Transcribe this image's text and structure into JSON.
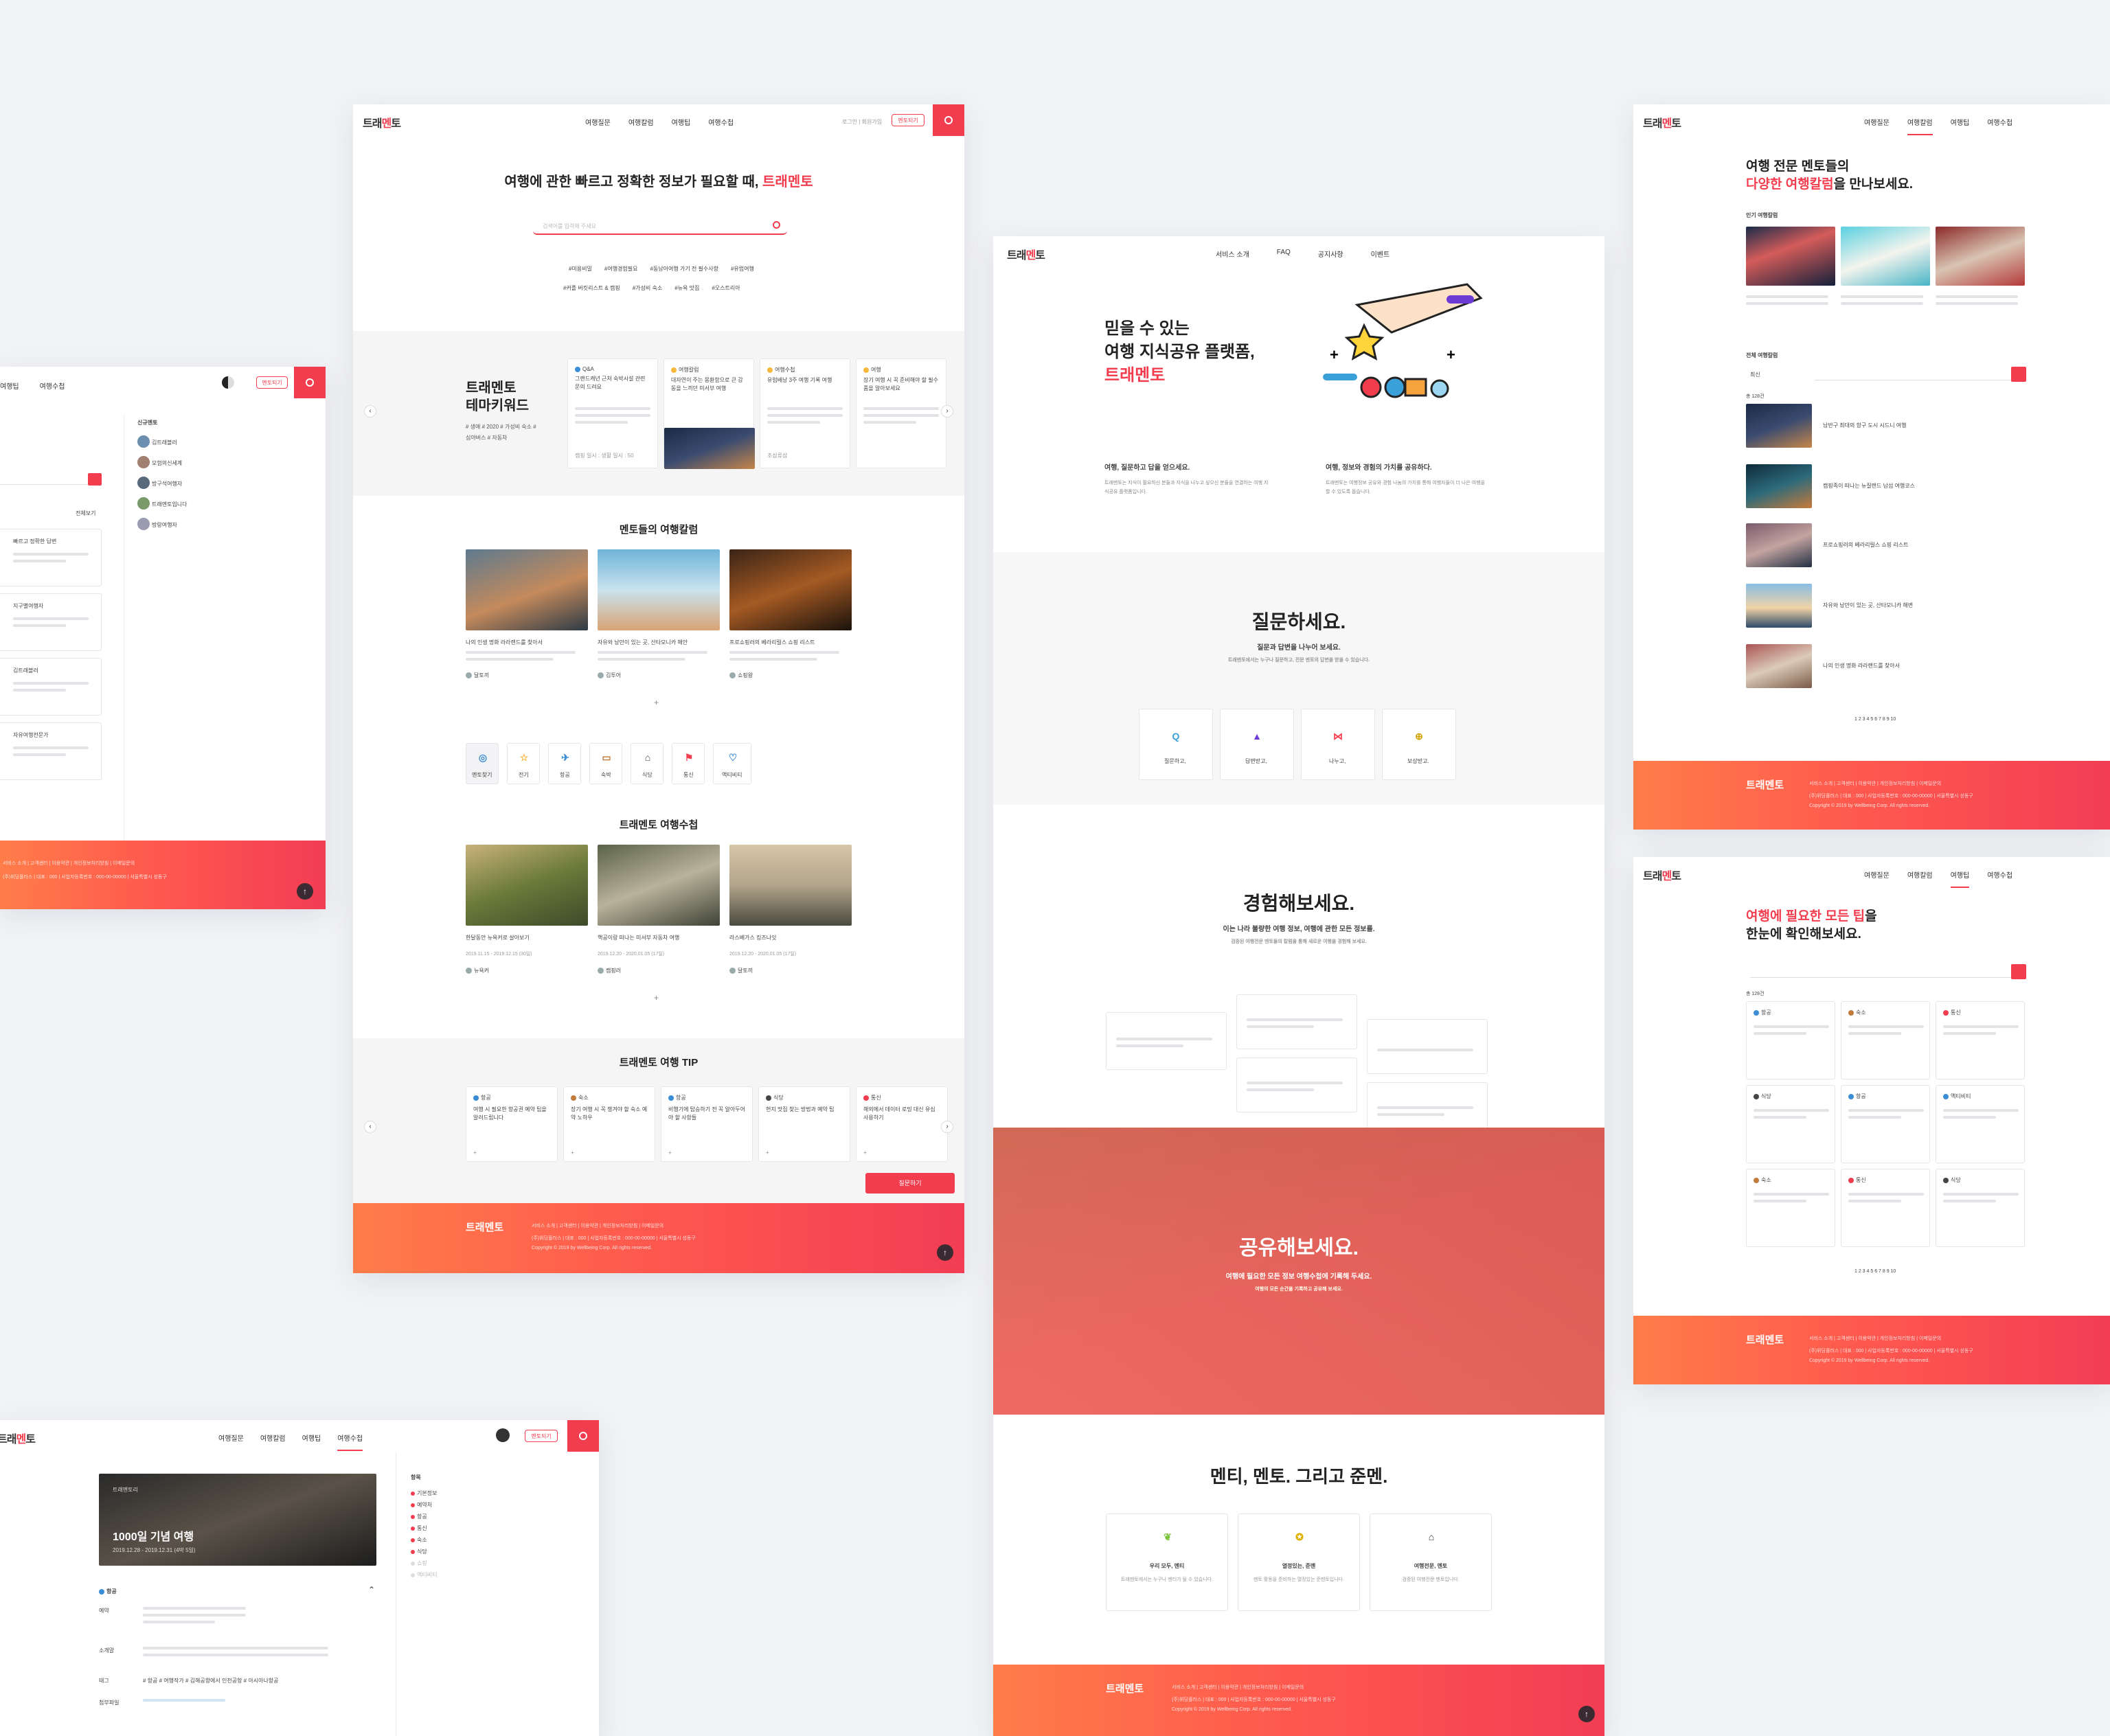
{
  "brand": {
    "logo_a": "트래",
    "logo_b": "멘",
    "logo_c": "토",
    "accent": "#f23d4f"
  },
  "nav": {
    "qa": "여행질문",
    "column": "여행칼럼",
    "tip": "여행팁",
    "essay": "여행수첩",
    "login": "로그인",
    "join": "회원가입",
    "mentor": "멘토되기"
  },
  "nav2": {
    "about": "서비스 소개",
    "faq": "FAQ",
    "notice": "공지사항",
    "event": "이벤트"
  },
  "main": {
    "hero_a": "여행에 관한 빠르고 정확한 정보가 필요할 때, ",
    "hero_b": "트래멘토",
    "search_placeholder": "검색어를 입력해 주세요",
    "tags1": [
      "#미용비밀",
      "#여행경험필요",
      "#동남아여행 가기 전 필수사항",
      "#유럽여행"
    ],
    "tags2": [
      "#커플 버킷리스트 & 캠핑",
      "#가성비 숙소",
      "#뉴욕 맛집",
      "#오스트리아"
    ],
    "keyword_title_1": "트래멘토",
    "keyword_title_2": "테마키워드",
    "keyword_tags": "# 생애  # 2020  # 가성비 숙소  # 심야버스  # 자동차",
    "theme_cards": [
      {
        "cat": "Q&A",
        "text": "그랜드캐년 근처 숙박시설 관련 문의 드려요",
        "user": "캠핑 일시 : 생활 일시 : 50"
      },
      {
        "cat": "여행칼럼",
        "text": "대자연이 주는 몽환함으로 큰 감동을 느끼던 미서부 여행",
        "user": "별나라"
      },
      {
        "cat": "여행수첩",
        "text": "유럽배낭 3주 여행 기록 여행",
        "user": "조삼류삼"
      },
      {
        "cat": "여행",
        "text": "장기 여행 시 꼭 준비해야 할 필수품을 알아보세요",
        "user": ""
      }
    ],
    "column_title": "멘토들의 여행칼럼",
    "columns": [
      {
        "title": "나의 인생 명화 라라랜드를 찾아서",
        "user": "달토끼"
      },
      {
        "title": "자유와 낭만이 있는 곳, 산타모니카 해안",
        "user": "김투어"
      },
      {
        "title": "프로쇼핑러의 베라리릴스 쇼핑 리스트",
        "user": "쇼핑왕"
      }
    ],
    "categories": [
      "멘토찾기",
      "전기",
      "항공",
      "숙박",
      "식당",
      "통신",
      "액티비티"
    ],
    "essay_title": "트래멘토 여행수첩",
    "essays": [
      {
        "title": "한달동안 뉴욕커로 살아보기",
        "meta": "2019.11.15 - 2019.12.15 (30일)",
        "user": "뉴욕커"
      },
      {
        "title": "핵공이랑 떠나는 미서부 자동차 여행",
        "meta": "2019.12.20 - 2020.01.05 (17일)",
        "user": "캠핑러"
      },
      {
        "title": "라스베가스 킹즈나잇",
        "meta": "2019.12.20 - 2020.01.05 (17일)",
        "user": "달토끼"
      }
    ],
    "tip_title": "트래멘토 여행 TIP",
    "tips": [
      {
        "cat": "항공",
        "text": "여행 시 필요한 항공권 예약 팁을 알려드립니다"
      },
      {
        "cat": "숙소",
        "text": "장기 여행 시 꼭 챙겨야 할 숙소 예약 노하우"
      },
      {
        "cat": "항공",
        "text": "비행기에 탑승하기 전 꼭 알아두어야 할 사항들"
      },
      {
        "cat": "식당",
        "text": "현지 맛집 찾는 방법과 예약 팁"
      },
      {
        "cat": "통신",
        "text": "해외에서 데이터 로밍 대신 유심 사용하기"
      }
    ],
    "more_button": "질문하기"
  },
  "footer": {
    "logo": "트래멘토",
    "links": "서비스 소개 | 고객센터 | 이용약관 | 개인정보처리방침 | 이메일문의",
    "info": "(주)위딩플러스 | 대표 : 000 | 사업자등록번호 : 000-00-00000 | 서울특별시 성동구",
    "copy": "Copyright © 2019 by Wellbeing Corp. All rights reserved."
  },
  "about": {
    "hero_a": "믿을 수 있는",
    "hero_b": "여행 지식공유 플랫폼,",
    "hero_c": "트래멘토",
    "col1_title": "여행, 질문하고 답을 얻으세요.",
    "col1_text": "트래멘토는 지식이 필요하신 분들과 지식을 나누고 싶으신 분들을 연결하는 여행 지식공유 플랫폼입니다.",
    "col2_title": "여행, 정보와 경험의 가치를 공유하다.",
    "col2_text": "트래멘토는 여행정보 공유와 경험 나눔의 가치를 통해 여행자들이 더 나은 여행을 할 수 있도록 돕습니다.",
    "ask_title": "질문하세요.",
    "ask_sub": "질문과 답변을 나누어 보세요.",
    "ask_text": "트래멘토에서는 누구나 질문하고, 전문 멘토의 답변을 받을 수 있습니다.",
    "steps": [
      "질문하고,",
      "답변받고,",
      "나누고,",
      "보상받고."
    ],
    "exp_title": "경험해보세요.",
    "exp_sub": "이는 나라 불량한 여행 정보, 여행에 관한 모든 정보를.",
    "exp_text": "검증된 여행전문 멘토들의 칼럼을 통해 새로운 여행을 경험해 보세요.",
    "share_title": "공유해보세요.",
    "share_sub": "여행에 필요한 모든 정보 여행수첩에 기록해 두세요.",
    "share_text": "여행의 모든 순간을 기록하고 공유해 보세요.",
    "roles_title": "멘티, 멘토. 그리고 준멘.",
    "roles": [
      {
        "name": "우리 모두, 멘티",
        "text": "트래멘토에서는 누구나 멘티가 될 수 있습니다."
      },
      {
        "name": "열정있는, 준멘",
        "text": "멘토 활동을 준비하는 열정있는 준멘토입니다."
      },
      {
        "name": "여행전문, 멘토",
        "text": "검증된 여행전문 멘토입니다."
      }
    ]
  },
  "columns_page": {
    "title_a": "여행 전문 멘토들의",
    "title_b": "다양한 여행칼럼",
    "title_c": "을 만나보세요.",
    "popular": "인기 여행칼럼",
    "all": "전체 여행칼럼",
    "sort": "최신",
    "count": "총 128건",
    "rows": [
      "남반구 최대의 항구 도시 시드니 여행",
      "캠핑족이 떠나는 뉴질랜드 남섬 여행코스",
      "프로쇼핑러의 베라리릴스 쇼핑 리스트",
      "자유와 낭만이 있는 곳, 산타모니카 해변",
      "나의 인생 명화 라라랜드를 찾아서"
    ],
    "pager": "1 2 3 4 5 6 7 8 9 10"
  },
  "tips_page": {
    "title_a": "여행에 필요한 모든 팁",
    "title_b": "을",
    "title_c": "한눈에 확인해보세요.",
    "count": "총 128건",
    "cats": [
      "항공",
      "숙소",
      "통신",
      "식당",
      "항공",
      "액티비티",
      "숙소",
      "통신",
      "식당"
    ]
  },
  "mentor_page": {
    "label": "신규멘토",
    "mentors": [
      "김트래블러",
      "모험의신세계",
      "방구석여행자",
      "트래멘토입니다",
      "방랑여행자"
    ],
    "sort": "전체보기",
    "list": [
      "빠르고 정확한 답변",
      "지구별여행자",
      "김트래블러",
      "자유여행전문가"
    ]
  },
  "essay_page": {
    "title": "1000일 기념 여행",
    "user": "트래멘토리",
    "date": "2019.12.28 - 2019.12.31 (4박 5일)",
    "side_title": "항목",
    "side_items": [
      "기본정보",
      "예약처",
      "항공",
      "통신",
      "숙소",
      "식당",
      "쇼핑",
      "액티비티"
    ],
    "section": "항공",
    "labels": [
      "예약",
      "소개말",
      "태그",
      "첨부파일"
    ],
    "tags": "# 항공  # 여행작가  # 김해공항에서 인천공항  # 아시아나항공"
  }
}
